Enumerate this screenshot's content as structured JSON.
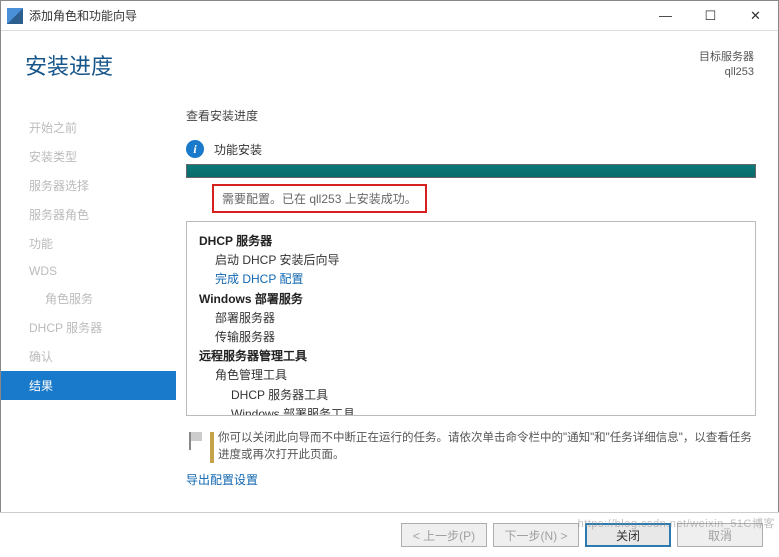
{
  "window": {
    "title": "添加角色和功能向导"
  },
  "header": {
    "title": "安装进度",
    "target_label": "目标服务器",
    "target_value": "qll253"
  },
  "steps": [
    {
      "label": "开始之前",
      "indent": false,
      "active": false
    },
    {
      "label": "安装类型",
      "indent": false,
      "active": false
    },
    {
      "label": "服务器选择",
      "indent": false,
      "active": false
    },
    {
      "label": "服务器角色",
      "indent": false,
      "active": false
    },
    {
      "label": "功能",
      "indent": false,
      "active": false
    },
    {
      "label": "WDS",
      "indent": false,
      "active": false
    },
    {
      "label": "角色服务",
      "indent": true,
      "active": false
    },
    {
      "label": "DHCP 服务器",
      "indent": false,
      "active": false
    },
    {
      "label": "确认",
      "indent": false,
      "active": false
    },
    {
      "label": "结果",
      "indent": false,
      "active": true
    }
  ],
  "main": {
    "view_label": "查看安装进度",
    "info_label": "功能安装",
    "status_text": "需要配置。已在 qll253 上安装成功。",
    "results": {
      "r0": "DHCP 服务器",
      "r1": "启动 DHCP 安装后向导",
      "r2": "完成 DHCP 配置",
      "r3": "Windows 部署服务",
      "r4": "部署服务器",
      "r5": "传输服务器",
      "r6": "远程服务器管理工具",
      "r7": "角色管理工具",
      "r8": "DHCP 服务器工具",
      "r9": "Windows 部署服务工具"
    },
    "note": "你可以关闭此向导而不中断正在运行的任务。请依次单击命令栏中的\"通知\"和\"任务详细信息\"，以查看任务进度或再次打开此页面。",
    "export_link": "导出配置设置"
  },
  "buttons": {
    "prev": "< 上一步(P)",
    "next": "下一步(N) >",
    "close": "关闭",
    "cancel": "取消"
  },
  "watermark": "https://blog.csdn.net/weixin_51C博客"
}
